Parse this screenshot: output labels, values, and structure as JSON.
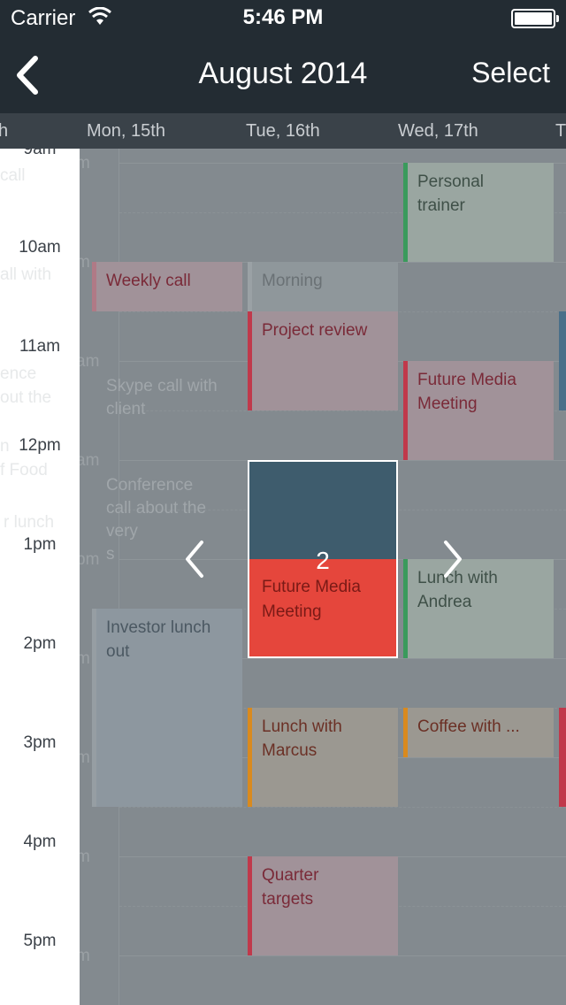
{
  "status": {
    "carrier": "Carrier",
    "time": "5:46 PM"
  },
  "nav": {
    "title": "August 2014",
    "select": "Select"
  },
  "days": {
    "prev": "h",
    "mon": "Mon, 15th",
    "tue": "Tue, 16th",
    "wed": "Wed, 17th",
    "next": "T"
  },
  "hours": [
    "9am",
    "10am",
    "11am",
    "12pm",
    "1pm",
    "2pm",
    "3pm",
    "4pm",
    "5pm"
  ],
  "ghost": {
    "left": [
      "call",
      "all with",
      "ence",
      "out the",
      "n",
      "f Food",
      "r lunch"
    ],
    "hour_frags": [
      "m",
      "m",
      "am",
      "am",
      "pm",
      "m",
      "m",
      "m",
      "m"
    ],
    "mon_extra": [
      "s"
    ]
  },
  "events": {
    "mon": {
      "weekly_call": "Weekly call",
      "skype_line1": "Skype call with",
      "skype_line2": "client",
      "conf_line1": "Conference",
      "conf_line2": "call about the",
      "conf_line3": "very",
      "investor_line1": "Investor lunch",
      "investor_line2": "out"
    },
    "tue": {
      "morning": "Morning",
      "project_review": "Project review",
      "lunch_marcus_1": "Lunch with",
      "lunch_marcus_2": "Marcus",
      "quarter_1": "Quarter",
      "quarter_2": "targets"
    },
    "wed": {
      "trainer_1": "Personal",
      "trainer_2": "trainer",
      "fmm_1": "Future Media",
      "fmm_2": "Meeting",
      "andrea_1": "Lunch with",
      "andrea_2": "Andrea",
      "coffee": "Coffee with ..."
    }
  },
  "popup": {
    "count": "2",
    "label_1": "Future Media",
    "label_2": "Meeting"
  },
  "colors": {
    "header": "#232c33",
    "popup_top": "#3e5c6d",
    "popup_bottom": "#e5463c",
    "green": "#3a9a5c",
    "red": "#c0394b",
    "orange": "#d98a1e",
    "blue": "#4a6f89"
  }
}
